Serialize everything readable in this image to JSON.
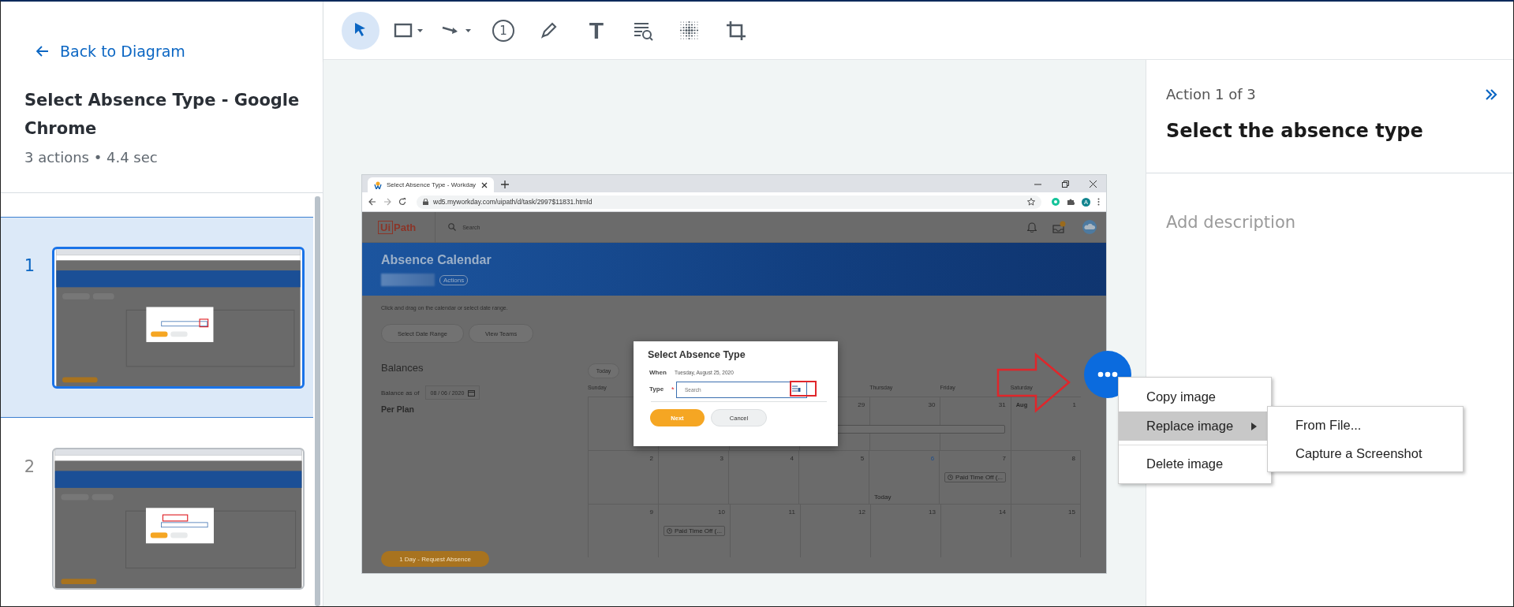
{
  "left_panel": {
    "back_link": "Back to Diagram",
    "title": "Select Absence Type - Google Chrome",
    "summary": "3 actions • 4.4 sec",
    "steps": [
      {
        "number": "1",
        "selected": true
      },
      {
        "number": "2",
        "selected": false
      }
    ]
  },
  "toolbar": {
    "tools": [
      {
        "kind": "select",
        "selected": true,
        "has_menu": false
      },
      {
        "kind": "rectangle",
        "selected": false,
        "has_menu": true
      },
      {
        "kind": "arrow",
        "selected": false,
        "has_menu": true
      },
      {
        "kind": "step",
        "label": "1",
        "selected": false,
        "has_menu": false
      },
      {
        "kind": "pencil",
        "selected": false,
        "has_menu": false
      },
      {
        "kind": "text",
        "label": "T",
        "selected": false,
        "has_menu": false
      },
      {
        "kind": "text-search",
        "selected": false,
        "has_menu": false
      },
      {
        "kind": "blur",
        "selected": false,
        "has_menu": false
      },
      {
        "kind": "crop",
        "selected": false,
        "has_menu": false
      }
    ]
  },
  "screenshot": {
    "browser": {
      "tab_title": "Select Absence Type - Workday",
      "url": "wd5.myworkday.com/uipath/d/task/2997$11831.htmld",
      "profile_initial": "A"
    },
    "app": {
      "logo": {
        "boxed": "Ui",
        "rest": "Path"
      },
      "search_placeholder": "Search",
      "banner_title": "Absence Calendar",
      "actions_label": "Actions",
      "hint": "Click and drag on the calendar or select date range.",
      "buttons": [
        "Select Date Range",
        "View Teams"
      ],
      "balances": {
        "title": "Balances",
        "as_of_label": "Balance as of",
        "as_of_value": "08 / 06 / 2020",
        "plan": "Per Plan"
      },
      "request_button": "1 Day - Request Absence",
      "calendar": {
        "today_button": "Today",
        "weekdays": [
          {
            "kind": "label",
            "label": "Sunday"
          },
          {
            "kind": "covered"
          },
          {
            "kind": "covered"
          },
          {
            "kind": "covered"
          },
          {
            "kind": "label",
            "label": "Thursday"
          },
          {
            "kind": "label",
            "label": "Friday"
          },
          {
            "kind": "label",
            "label": "Saturday"
          }
        ],
        "weeks": [
          {
            "event_bar": true,
            "days": [
              {
                "kind": "covered"
              },
              {
                "kind": "covered"
              },
              {
                "kind": "covered"
              },
              {
                "kind": "day",
                "label": "29",
                "today": false
              },
              {
                "kind": "day",
                "label": "30",
                "today": false
              },
              {
                "kind": "day",
                "label": "31",
                "today": false
              },
              {
                "kind": "day",
                "month": "Aug",
                "label": "1",
                "today": false
              }
            ]
          },
          {
            "event_bar": false,
            "days": [
              {
                "kind": "day",
                "label": "2",
                "today": false
              },
              {
                "kind": "day",
                "label": "3",
                "today": false
              },
              {
                "kind": "day",
                "label": "4",
                "today": false
              },
              {
                "kind": "day",
                "label": "5",
                "today": false
              },
              {
                "kind": "day",
                "label": "6",
                "today": true,
                "note": "Today"
              },
              {
                "kind": "day",
                "label": "7",
                "today": false,
                "event": "Paid Time Off (..."
              },
              {
                "kind": "day",
                "label": "8",
                "today": false
              }
            ]
          },
          {
            "event_bar": false,
            "days": [
              {
                "kind": "day",
                "label": "9",
                "today": false
              },
              {
                "kind": "day",
                "label": "10",
                "today": false,
                "event": "Paid Time Off (..."
              },
              {
                "kind": "day",
                "label": "11",
                "today": false
              },
              {
                "kind": "day",
                "label": "12",
                "today": false
              },
              {
                "kind": "day",
                "label": "13",
                "today": false
              },
              {
                "kind": "day",
                "label": "14",
                "today": false
              },
              {
                "kind": "day",
                "label": "15",
                "today": false
              }
            ]
          }
        ]
      },
      "dialog": {
        "title": "Select Absence Type",
        "when_label": "When",
        "when_value": "Tuesday, August 25, 2020",
        "type_label": "Type",
        "required_mark": "*",
        "type_placeholder": "Search",
        "primary": "Next",
        "secondary": "Cancel"
      }
    }
  },
  "context_menu": {
    "items": [
      {
        "label": "Copy image",
        "highlighted": false,
        "has_submenu": false,
        "divider_before": false
      },
      {
        "label": "Replace image",
        "highlighted": true,
        "has_submenu": true,
        "divider_before": false
      },
      {
        "label": "Delete image",
        "highlighted": false,
        "has_submenu": false,
        "divider_before": true
      }
    ]
  },
  "submenu": {
    "items": [
      {
        "label": "From File..."
      },
      {
        "label": "Capture a Screenshot"
      }
    ]
  },
  "action_panel": {
    "counter": "Action 1 of 3",
    "title": "Select the absence type",
    "description_placeholder": "Add description"
  }
}
